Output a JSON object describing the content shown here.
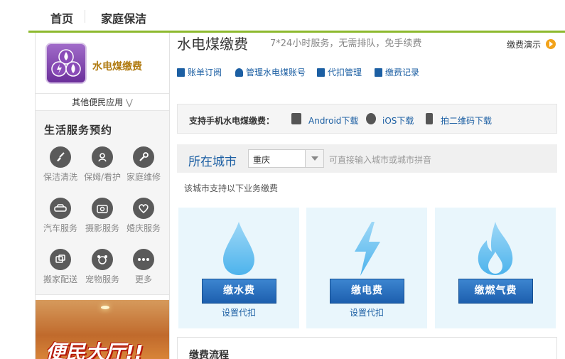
{
  "topnav": {
    "home": "首页",
    "cleaning": "家庭保洁"
  },
  "sidebar": {
    "app_name": "水电煤缴费",
    "others_label": "其他便民应用",
    "section_title": "生活服务预约",
    "services": [
      {
        "label": "保洁清洗",
        "icon": "broom-icon"
      },
      {
        "label": "保姆/看护",
        "icon": "nanny-icon"
      },
      {
        "label": "家庭维修",
        "icon": "wrench-icon"
      },
      {
        "label": "汽车服务",
        "icon": "car-icon"
      },
      {
        "label": "摄影服务",
        "icon": "camera-icon"
      },
      {
        "label": "婚庆服务",
        "icon": "heart-icon"
      },
      {
        "label": "搬家配送",
        "icon": "moving-icon"
      },
      {
        "label": "宠物服务",
        "icon": "pet-icon"
      },
      {
        "label": "更多",
        "icon": "more-icon"
      }
    ],
    "banner_text": "便民大厅!!"
  },
  "main": {
    "title": "水电煤缴费",
    "subtitle": "7*24小时服务，无需排队，免手续费",
    "demo": "缴费演示",
    "links": [
      "账单订阅",
      "管理水电煤账号",
      "代扣管理",
      "缴费记录"
    ],
    "mobile": {
      "label": "支持手机水电煤缴费：",
      "android": "Android下载",
      "ios": "iOS下载",
      "qr": "拍二维码下载"
    },
    "city": {
      "label": "所在城市",
      "value": "重庆",
      "hint": "可直接输入城市或城市拼音"
    },
    "support_text": "该城市支持以下业务缴费",
    "cards": [
      {
        "button": "缴水费",
        "setup": "设置代扣"
      },
      {
        "button": "缴电费",
        "setup": "设置代扣"
      },
      {
        "button": "缴燃气费",
        "setup": ""
      }
    ],
    "flow_title": "缴费流程"
  },
  "colors": {
    "accent_green": "#8db92e",
    "link_blue": "#1c5fa3",
    "card_bg": "#e9f6fc",
    "button_blue": "#2b74c3"
  }
}
